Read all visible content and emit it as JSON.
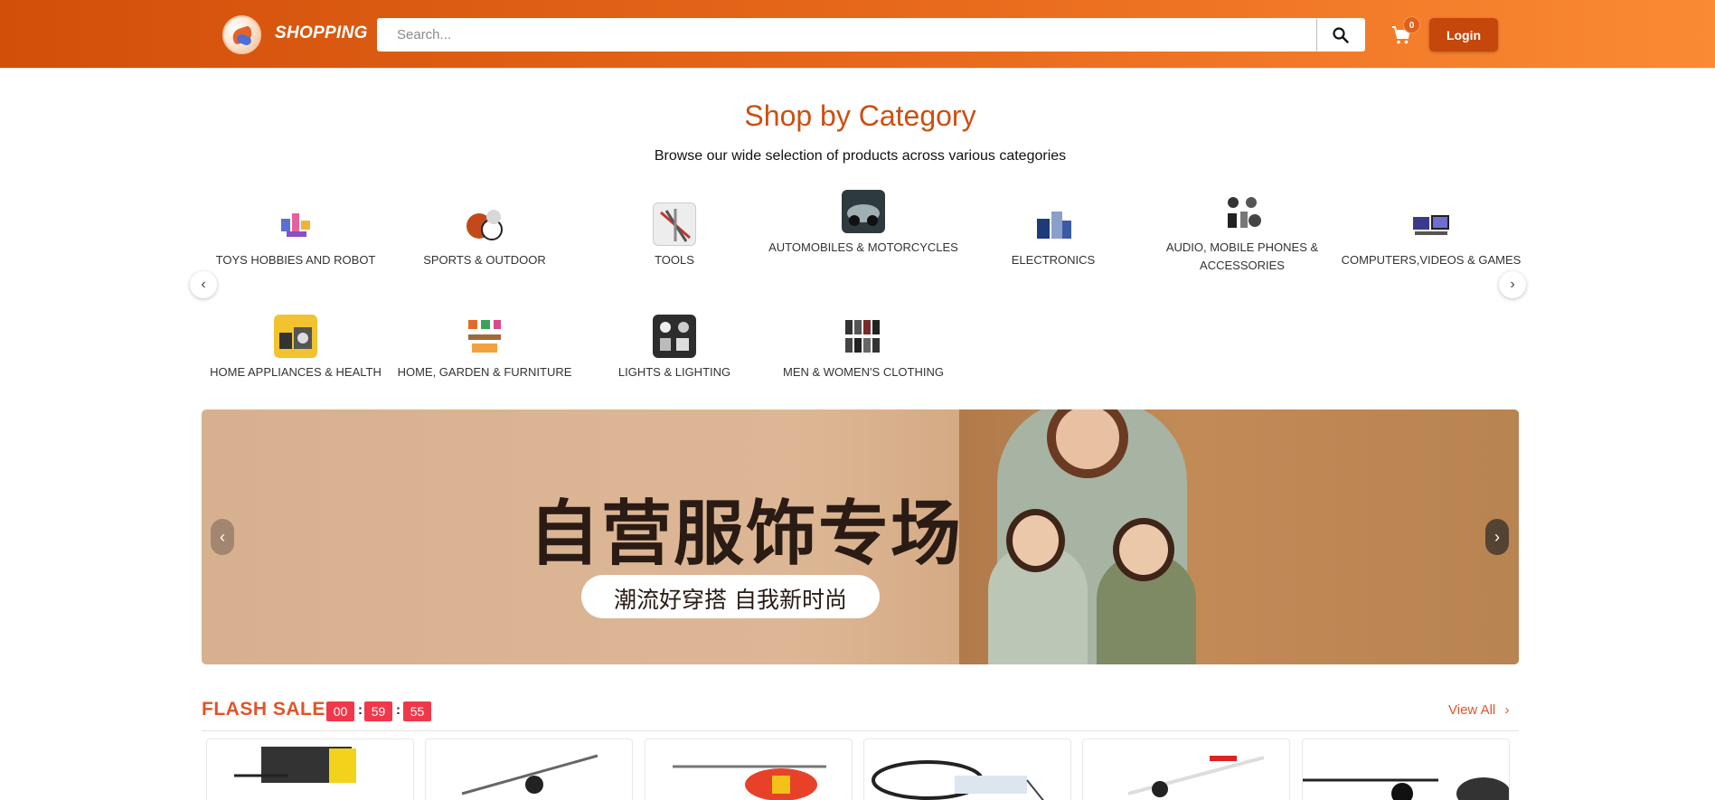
{
  "header": {
    "brand": "SHOPPING",
    "search_placeholder": "Search...",
    "cart_count": "0",
    "login_label": "Login",
    "colors": {
      "gradient_start": "#d24f0a",
      "gradient_end": "#fb8a34",
      "login_bg": "#c5470b"
    },
    "icons": {
      "logo": "shopping-logo-icon",
      "search": "search-icon",
      "cart": "cart-icon"
    }
  },
  "categories": {
    "title": "Shop by Category",
    "subtitle": "Browse our wide selection of products across various categories",
    "items": [
      {
        "label": "TOYS HOBBIES AND ROBOT"
      },
      {
        "label": "SPORTS & OUTDOOR"
      },
      {
        "label": "TOOLS"
      },
      {
        "label": "AUTOMOBILES & MOTORCYCLES"
      },
      {
        "label": "ELECTRONICS"
      },
      {
        "label": "AUDIO, MOBILE PHONES & ACCESSORIES"
      },
      {
        "label": "COMPUTERS,VIDEOS & GAMES"
      },
      {
        "label": "HOME APPLIANCES & HEALTH"
      },
      {
        "label": "HOME, GARDEN & FURNITURE"
      },
      {
        "label": "LIGHTS & LIGHTING"
      },
      {
        "label": "MEN & WOMEN'S CLOTHING"
      }
    ],
    "prev_icon": "chevron-left-icon",
    "next_icon": "chevron-right-icon",
    "title_color": "#cc4f12"
  },
  "banner": {
    "title": "自营服饰专场",
    "subtitle": "潮流好穿搭  自我新时尚"
  },
  "flash_sale": {
    "title": "FLASH SALE",
    "timer": {
      "hours": "00",
      "minutes": "59",
      "seconds": "55"
    },
    "view_all": "View All",
    "accent_color": "#e0542a",
    "timer_color": "#f1384a",
    "products": [
      {
        "icon": "rc-helicopter-yellow-icon"
      },
      {
        "icon": "rc-helicopter-black-icon"
      },
      {
        "icon": "rc-helicopter-red-icon"
      },
      {
        "icon": "rc-aircraft-icon"
      },
      {
        "icon": "rc-helicopter-white-icon"
      },
      {
        "icon": "rc-helicopter-dark-icon"
      }
    ]
  }
}
